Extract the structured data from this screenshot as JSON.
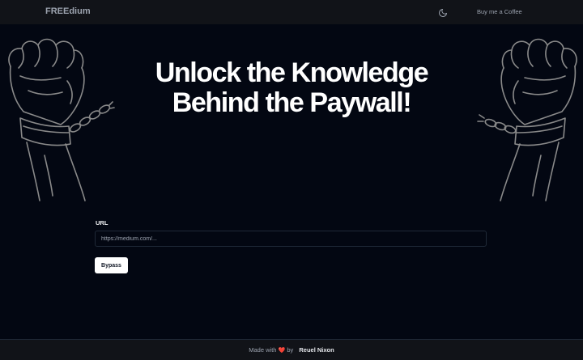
{
  "header": {
    "brand": "FREEdium",
    "theme_toggle_icon": "moon-icon",
    "coffee_label": "Buy me a Coffee"
  },
  "hero": {
    "title_line1": "Unlock the Knowledge",
    "title_line2": "Behind the Paywall!",
    "illustration_icon": "raised-fist-broken-chain-icon"
  },
  "form": {
    "url_label": "URL",
    "url_placeholder": "https://medium.com/...",
    "url_value": "",
    "submit_label": "Bypass"
  },
  "footer": {
    "made_with": "Made with",
    "heart_icon": "heart-icon",
    "by": "by",
    "author": "Reuel Nixon"
  },
  "colors": {
    "background": "#030712",
    "header_bg": "#111318",
    "accent_heart": "#ef4444",
    "button_bg": "#ffffff"
  }
}
